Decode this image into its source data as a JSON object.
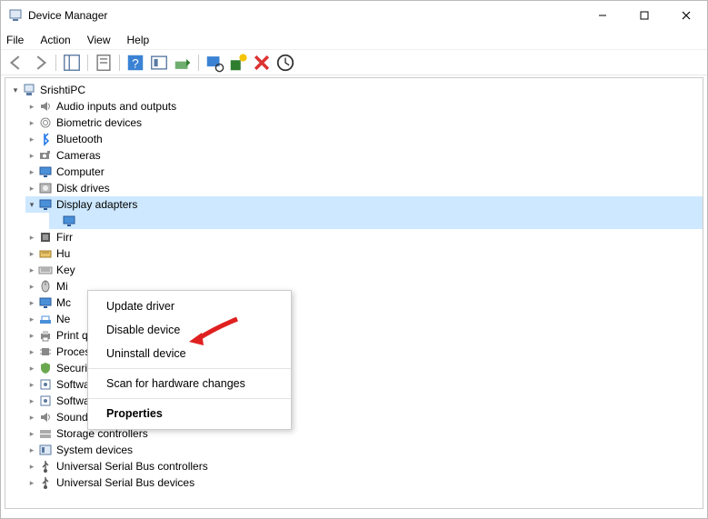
{
  "window": {
    "title": "Device Manager"
  },
  "menubar": {
    "items": [
      "File",
      "Action",
      "View",
      "Help"
    ]
  },
  "tree": {
    "root": "SrishtiPC",
    "categories": [
      {
        "label": "Audio inputs and outputs",
        "icon": "speaker"
      },
      {
        "label": "Biometric devices",
        "icon": "fingerprint"
      },
      {
        "label": "Bluetooth",
        "icon": "bluetooth"
      },
      {
        "label": "Cameras",
        "icon": "camera"
      },
      {
        "label": "Computer",
        "icon": "monitor"
      },
      {
        "label": "Disk drives",
        "icon": "disk"
      },
      {
        "label": "Display adapters",
        "icon": "monitor",
        "expanded": true,
        "selected": true,
        "children": [
          {
            "label": "",
            "icon": "monitor",
            "selected": true
          }
        ]
      },
      {
        "label": "Firr",
        "icon": "firmware",
        "partial": true
      },
      {
        "label": "Hu",
        "icon": "hid",
        "partial": true
      },
      {
        "label": "Key",
        "icon": "keyboard",
        "partial": true
      },
      {
        "label": "Mi",
        "icon": "mouse",
        "partial": true
      },
      {
        "label": "Mc",
        "icon": "monitor",
        "partial": true
      },
      {
        "label": "Ne",
        "icon": "network",
        "partial": true
      },
      {
        "label": "Print queues",
        "icon": "printer",
        "partial_label": "Prir"
      },
      {
        "label": "Processors",
        "icon": "cpu"
      },
      {
        "label": "Security devices",
        "icon": "security"
      },
      {
        "label": "Software components",
        "icon": "component"
      },
      {
        "label": "Software devices",
        "icon": "component"
      },
      {
        "label": "Sound, video and game controllers",
        "icon": "speaker"
      },
      {
        "label": "Storage controllers",
        "icon": "storage"
      },
      {
        "label": "System devices",
        "icon": "system"
      },
      {
        "label": "Universal Serial Bus controllers",
        "icon": "usb"
      },
      {
        "label": "Universal Serial Bus devices",
        "icon": "usb"
      }
    ]
  },
  "contextMenu": {
    "items": [
      {
        "label": "Update driver"
      },
      {
        "label": "Disable device"
      },
      {
        "label": "Uninstall device"
      },
      {
        "sep": true
      },
      {
        "label": "Scan for hardware changes"
      },
      {
        "sep": true
      },
      {
        "label": "Properties",
        "bold": true
      }
    ]
  }
}
